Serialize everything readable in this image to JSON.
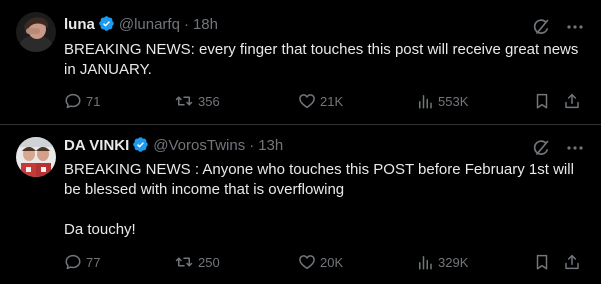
{
  "colors": {
    "background": "#000000",
    "text_primary": "#e7e9ea",
    "text_secondary": "#71767b",
    "verified_blue": "#1d9bf0",
    "divider": "#2f3336"
  },
  "tweets": [
    {
      "author_name": "luna",
      "handle": "@lunarfq",
      "separator": "·",
      "time": "18h",
      "verified": true,
      "text": [
        "BREAKING NEWS: every finger that touches this post will receive great news in JANUARY."
      ],
      "stats": {
        "replies": "71",
        "retweets": "356",
        "likes": "21K",
        "views": "553K"
      },
      "icons": [
        "grok-icon",
        "more-icon",
        "reply-icon",
        "retweet-icon",
        "like-icon",
        "views-icon",
        "bookmark-icon",
        "share-icon"
      ]
    },
    {
      "author_name": "DA VINKI",
      "handle": "@VorosTwins",
      "separator": "·",
      "time": "13h",
      "verified": true,
      "text": [
        "BREAKING NEWS : Anyone who touches this POST before February 1st will be blessed with income that is overflowing",
        "Da touchy!"
      ],
      "stats": {
        "replies": "77",
        "retweets": "250",
        "likes": "20K",
        "views": "329K"
      },
      "icons": [
        "grok-icon",
        "more-icon",
        "reply-icon",
        "retweet-icon",
        "like-icon",
        "views-icon",
        "bookmark-icon",
        "share-icon"
      ]
    }
  ]
}
